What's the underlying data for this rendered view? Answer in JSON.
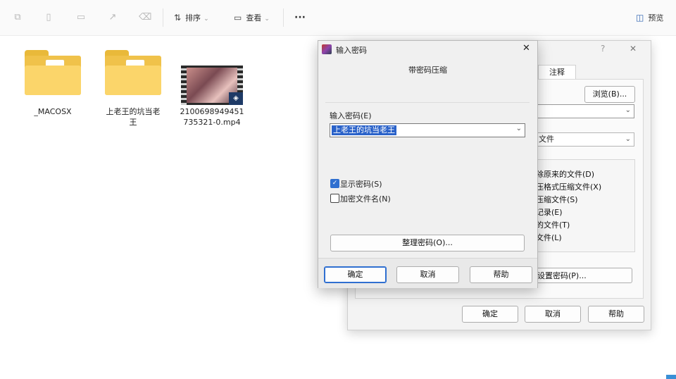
{
  "toolbar": {
    "icons": [
      "copy-icon",
      "paste-icon",
      "rename-icon",
      "share-icon",
      "delete-icon"
    ],
    "sort_label": "排序",
    "view_label": "查看",
    "more_label": "···",
    "preview_label": "预览"
  },
  "files": [
    {
      "name": "_MACOSX",
      "type": "folder"
    },
    {
      "name": "上老王的坑当老王",
      "type": "folder"
    },
    {
      "name": "2100698949451735321-0.mp4",
      "type": "video",
      "line1": "2100698949451",
      "line2": "735321-0.mp4"
    }
  ],
  "back_dialog": {
    "help_glyph": "?",
    "close_glyph": "✕",
    "tab_comment": "注释",
    "browse_label": "浏览(B)...",
    "dropdown_text": "文件",
    "options": [
      "除原来的文件(D)",
      "压格式压缩文件(X)",
      "压缩文件(S)",
      "记录(E)",
      "的文件(T)",
      "文件(L)"
    ],
    "set_password_label": "设置密码(P)...",
    "ok_label": "确定",
    "cancel_label": "取消",
    "help_label": "帮助"
  },
  "password_dialog": {
    "title": "输入密码",
    "subtitle": "带密码压缩",
    "close_glyph": "✕",
    "input_label": "输入密码(E)",
    "password_value": "上老王的坑当老王",
    "show_password_label": "显示密码(S)",
    "show_password_checked": true,
    "encrypt_names_label": "加密文件名(N)",
    "encrypt_names_checked": false,
    "organize_label": "整理密码(O)...",
    "ok_label": "确定",
    "cancel_label": "取消",
    "help_label": "帮助"
  }
}
